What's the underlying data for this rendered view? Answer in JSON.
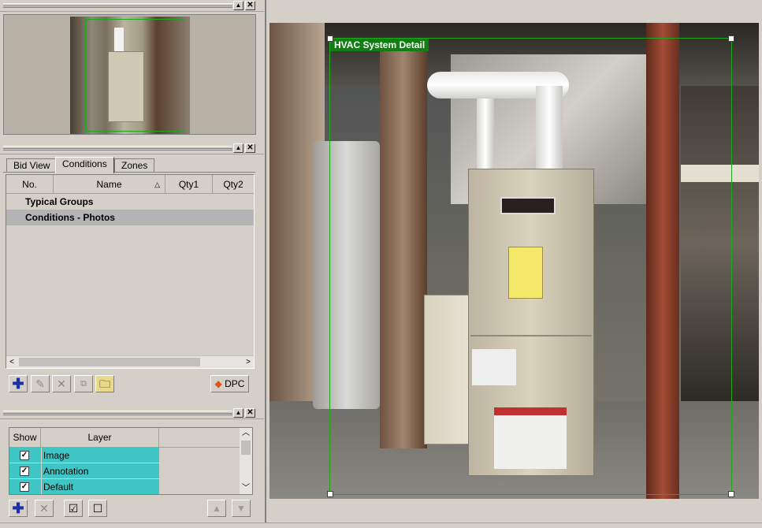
{
  "thumbnail_panel": {},
  "conditions_panel": {
    "tabs": [
      {
        "label": "Bid View"
      },
      {
        "label": "Conditions"
      },
      {
        "label": "Zones"
      }
    ],
    "columns": {
      "no": "No.",
      "name": "Name",
      "qty1": "Qty1",
      "qty2": "Qty2"
    },
    "rows": [
      {
        "name": "Typical Groups"
      },
      {
        "name": "Conditions - Photos"
      }
    ],
    "dpc_label": "DPC"
  },
  "layers_panel": {
    "columns": {
      "show": "Show",
      "layer": "Layer"
    },
    "layers": [
      {
        "name": "Image",
        "checked": true
      },
      {
        "name": "Annotation",
        "checked": true
      },
      {
        "name": "Default",
        "checked": true
      }
    ]
  },
  "viewer": {
    "markup_label": "HVAC System Detail"
  },
  "colors": {
    "markup_green": "#1ea81e",
    "layer_highlight": "#3fc6c4",
    "selected_row": "#b4b4b4"
  }
}
